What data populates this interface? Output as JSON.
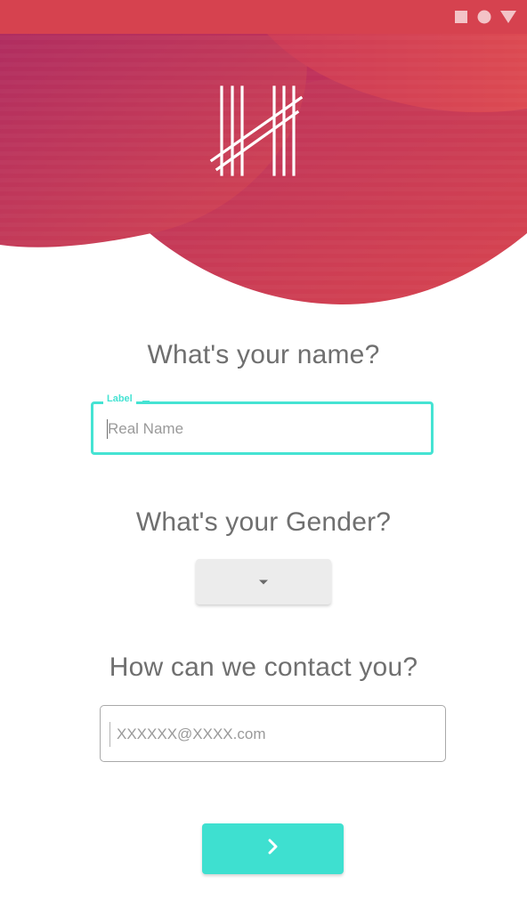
{
  "status_bar": {
    "icons": [
      "square-icon",
      "circle-icon",
      "triangle-down-icon"
    ]
  },
  "header": {
    "logo": "tally-marks-logo-icon"
  },
  "name_section": {
    "question": "What's your name?",
    "field_label": "Label",
    "placeholder": "Real Name",
    "value": ""
  },
  "gender_section": {
    "question": "What's your Gender?",
    "selected": "",
    "dropdown_icon": "caret-down-icon"
  },
  "contact_section": {
    "question": "How can we contact you?",
    "placeholder": "XXXXXX@XXXX.com",
    "value": ""
  },
  "next_button": {
    "icon": "chevron-right-icon"
  },
  "colors": {
    "status_bar": "#d6424f",
    "hero_dark": "#b02f5f",
    "hero_light": "#dc4a56",
    "accent_teal": "#3ee0d0",
    "question_text": "#6f6f6f",
    "select_bg": "#ececec"
  }
}
